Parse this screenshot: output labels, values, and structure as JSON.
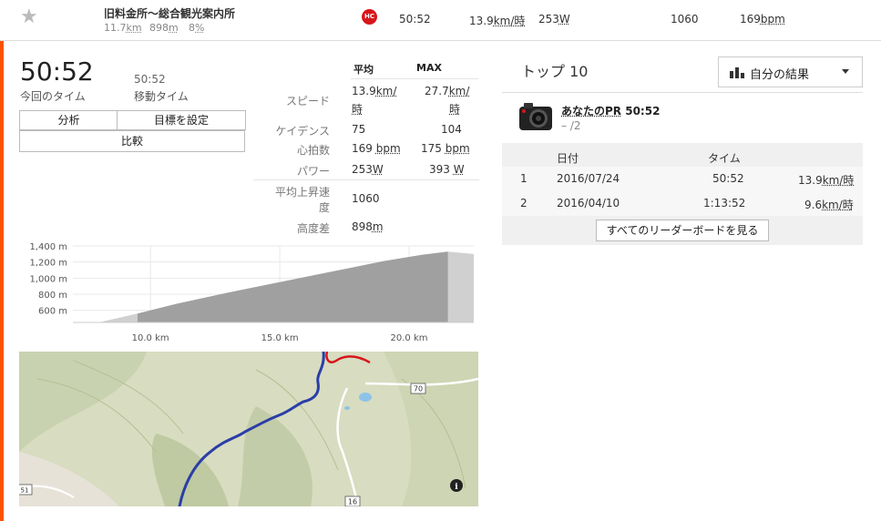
{
  "segment_row": {
    "name": "旧料金所～総合観光案内所",
    "distance": "11.7",
    "distance_unit": "km",
    "elevation": "898",
    "elevation_unit": "m",
    "grade": "8",
    "grade_unit": "%",
    "category": "HC",
    "time": "50:52",
    "speed": "13.9",
    "speed_unit": "km/時",
    "power": "253",
    "power_unit": "W",
    "vam": "1060",
    "hr": "169",
    "hr_unit": "bpm"
  },
  "effort": {
    "elapsed_time": "50:52",
    "elapsed_label": "今回のタイム",
    "moving_time": "50:52",
    "moving_label": "移動タイム",
    "buttons": {
      "analysis": "分析",
      "set_goal": "目標を設定",
      "compare": "比較"
    }
  },
  "stats": {
    "headers": {
      "avg": "平均",
      "max": "MAX"
    },
    "speed_label": "スピード",
    "speed_avg": "13.9",
    "speed_avg_unit_a": "km/",
    "speed_avg_unit_b": "時",
    "speed_max": "27.7",
    "speed_max_unit_a": "km/",
    "speed_max_unit_b": "時",
    "cadence_label": "ケイデンス",
    "cadence_avg": "75",
    "cadence_max": "104",
    "hr_label": "心拍数",
    "hr_avg": "169",
    "hr_avg_unit": "bpm",
    "hr_max": "175",
    "hr_max_unit": "bpm",
    "power_label": "パワー",
    "power_avg": "253",
    "power_avg_unit": "W",
    "power_max": "393",
    "power_max_unit": "W",
    "vam_label_a": "平均上昇速",
    "vam_label_b": "度",
    "vam_value": "1060",
    "elev_label": "高度差",
    "elev_value": "898",
    "elev_unit": "m"
  },
  "top10": {
    "title": "トップ 10",
    "filter_label": "自分の結果",
    "pr_label": "あなたのPR",
    "pr_time": "50:52",
    "pr_rank": "– /2",
    "columns": {
      "date": "日付",
      "time": "タイム"
    },
    "rows": [
      {
        "rank": "1",
        "date": "2016/07/24",
        "time": "50:52",
        "speed": "13.9",
        "speed_unit": "km/時"
      },
      {
        "rank": "2",
        "date": "2016/04/10",
        "time": "1:13:52",
        "speed": "9.6",
        "speed_unit": "km/時"
      }
    ],
    "view_all_label": "すべてのリーダーボードを見る"
  },
  "chart_data": {
    "type": "area",
    "xlabel": "",
    "ylabel": "",
    "x": [
      8.0,
      9.5,
      11.0,
      13.0,
      15.0,
      17.0,
      19.0,
      20.5,
      21.5,
      22.5
    ],
    "y": [
      450,
      560,
      680,
      820,
      950,
      1080,
      1210,
      1290,
      1330,
      1300
    ],
    "segment_range_km": [
      9.5,
      21.5
    ],
    "x_ticks": [
      "10.0 km",
      "15.0 km",
      "20.0 km"
    ],
    "x_tick_values": [
      10,
      15,
      20
    ],
    "y_ticks": [
      "1,400 m",
      "1,200 m",
      "1,000 m",
      "800 m",
      "600 m"
    ],
    "y_tick_values": [
      1400,
      1200,
      1000,
      800,
      600
    ],
    "xlim": [
      7.0,
      22.5
    ],
    "ylim": [
      450,
      1400
    ],
    "grid": true,
    "colors": {
      "segment": "#a0a0a0",
      "outside": "#d0d0d0"
    }
  },
  "map": {
    "road_labels": [
      "70",
      "16",
      "51"
    ],
    "info_icon": "info-icon",
    "colors": {
      "route": "#2a3ea8",
      "other_route": "#d8161b",
      "terrain": "#d9dcc3"
    }
  },
  "colors": {
    "accent": "#fc5200",
    "hc_badge": "#d8161b"
  }
}
